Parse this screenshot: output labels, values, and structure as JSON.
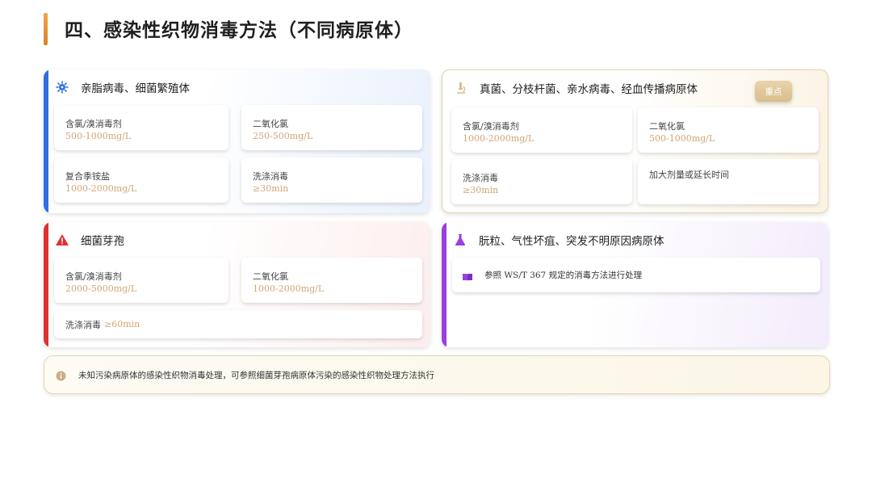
{
  "title": "四、感染性织物消毒方法（不同病原体）",
  "cards": [
    {
      "heading": "亲脂病毒、细菌繁殖体",
      "icon": "virus-icon",
      "accent": "#2f6fe4",
      "tiles": [
        {
          "name": "含氯/溴消毒剂",
          "value": "500-1000mg/L"
        },
        {
          "name": "二氧化氯",
          "value": "250-500mg/L"
        },
        {
          "name": "复合季铵盐",
          "value": "1000-2000mg/L"
        },
        {
          "name": "洗涤消毒",
          "value": "≥30min"
        }
      ]
    },
    {
      "heading": "真菌、分枝杆菌、亲水病毒、经血传播病原体",
      "icon": "microscope-icon",
      "badge": "重点",
      "accent": "#d9bd8c",
      "tiles": [
        {
          "name": "含氯/溴消毒剂",
          "value": "1000-2000mg/L"
        },
        {
          "name": "二氧化氯",
          "value": "500-1000mg/L"
        },
        {
          "name": "洗涤消毒",
          "value": "≥30min"
        },
        {
          "name": "加大剂量或延长时间",
          "value": ""
        }
      ]
    },
    {
      "heading": "细菌芽孢",
      "icon": "warning-icon",
      "accent": "#e0302e",
      "tiles": [
        {
          "name": "含氯/溴消毒剂",
          "value": "2000-5000mg/L"
        },
        {
          "name": "二氧化氯",
          "value": "1000-2000mg/L"
        },
        {
          "name": "洗涤消毒",
          "value": "≥60min"
        }
      ]
    },
    {
      "heading": "朊粒、气性坏疽、突发不明原因病原体",
      "icon": "flask-icon",
      "accent": "#9a3fe0",
      "reference": {
        "icon": "book-icon",
        "text": "参照 WS/T 367 规定的消毒方法进行处理"
      }
    }
  ],
  "note": {
    "icon": "info-icon",
    "text": "未知污染病原体的感染性织物消毒处理，可参照细菌芽孢病原体污染的感染性织物处理方法执行"
  },
  "colors": {
    "title_accent": "#e8963a",
    "value_text": "#d4a574"
  }
}
